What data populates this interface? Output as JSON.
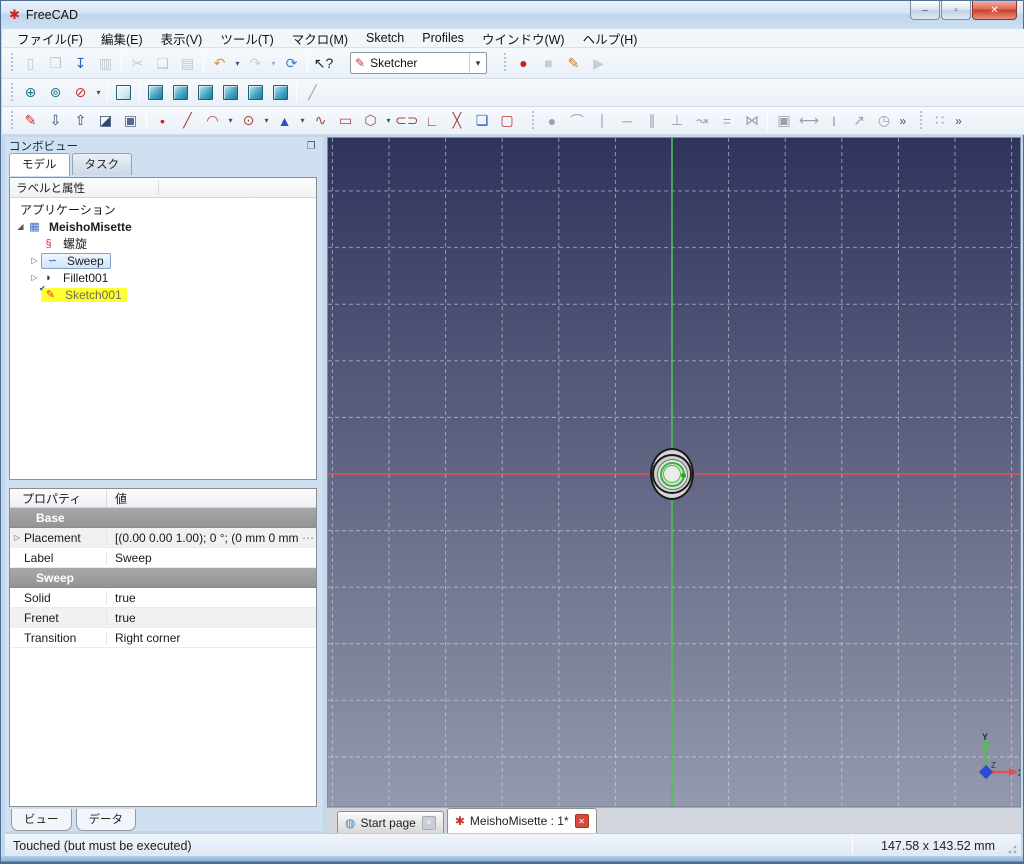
{
  "window": {
    "title": "FreeCAD",
    "icon": "freecad-logo-icon",
    "icon_glyph": "✱",
    "buttons": [
      {
        "id": "minimize",
        "glyph": "‒"
      },
      {
        "id": "maximize",
        "glyph": "▫"
      },
      {
        "id": "close",
        "glyph": "✕"
      }
    ]
  },
  "menu": {
    "items": [
      {
        "id": "file",
        "label": "ファイル(F)"
      },
      {
        "id": "edit",
        "label": "編集(E)"
      },
      {
        "id": "view",
        "label": "表示(V)"
      },
      {
        "id": "tools",
        "label": "ツール(T)"
      },
      {
        "id": "macro",
        "label": "マクロ(M)"
      },
      {
        "id": "sketch",
        "label": "Sketch"
      },
      {
        "id": "profiles",
        "label": "Profiles"
      },
      {
        "id": "windows",
        "label": "ウインドウ(W)"
      },
      {
        "id": "help",
        "label": "ヘルプ(H)"
      }
    ]
  },
  "workbench": {
    "selected": "Sketcher",
    "icon_glyph": "✎",
    "icon_color": "#cc3333"
  },
  "ui": {
    "dropdown_arrow": "▾",
    "overflow": "»",
    "expander_expanded": "◢",
    "expander_collapsed": "▷",
    "ellipsis": "⋯",
    "float_glyph": "❐",
    "close_glyph": "✕"
  },
  "toolbars": {
    "rows": [
      [
        {
          "k": "grip"
        },
        {
          "k": "btn",
          "n": "new-file-button",
          "g": "▯",
          "c": "#7e8ea0",
          "d": true
        },
        {
          "k": "btn",
          "n": "open-file-button",
          "g": "❒",
          "c": "#7e8ea0",
          "d": true
        },
        {
          "k": "btn",
          "n": "save-button",
          "g": "↧",
          "c": "#2f66c4"
        },
        {
          "k": "btn",
          "n": "print-button",
          "g": "▥",
          "c": "#7e8ea0",
          "d": true
        },
        {
          "k": "sep"
        },
        {
          "k": "btn",
          "n": "cut-button",
          "g": "✂",
          "c": "#7e8ea0",
          "d": true
        },
        {
          "k": "btn",
          "n": "copy-button",
          "g": "❏",
          "c": "#7e8ea0",
          "d": true
        },
        {
          "k": "btn",
          "n": "paste-button",
          "g": "▤",
          "c": "#7e8ea0",
          "d": true
        },
        {
          "k": "sep"
        },
        {
          "k": "btn",
          "n": "undo-button",
          "g": "↶",
          "c": "#d69a2a",
          "dd": true
        },
        {
          "k": "btn",
          "n": "redo-button",
          "g": "↷",
          "c": "#8e99a6",
          "d": true,
          "dd": true
        },
        {
          "k": "btn",
          "n": "refresh-button",
          "g": "⟳",
          "c": "#3a7bd5"
        },
        {
          "k": "sep"
        },
        {
          "k": "btn",
          "n": "whats-this-button",
          "g": "↖?",
          "c": "#20262e"
        },
        {
          "k": "gap",
          "w": 14
        },
        {
          "k": "combo"
        },
        {
          "k": "gap",
          "w": 12
        },
        {
          "k": "grip"
        },
        {
          "k": "btn",
          "n": "macro-record-button",
          "g": "●",
          "c": "#cf2020"
        },
        {
          "k": "btn",
          "n": "macro-stop-button",
          "g": "■",
          "c": "#8e99a6",
          "d": true
        },
        {
          "k": "btn",
          "n": "macro-edit-button",
          "g": "✎",
          "c": "#c07a28"
        },
        {
          "k": "btn",
          "n": "macro-play-button",
          "g": "▶",
          "c": "#8e99a6",
          "d": true
        }
      ],
      [
        {
          "k": "grip"
        },
        {
          "k": "btn",
          "n": "fit-all-button",
          "g": "⊕",
          "c": "#1f7a8c"
        },
        {
          "k": "btn",
          "n": "zoom-region-button",
          "g": "⊚",
          "c": "#1f7a8c"
        },
        {
          "k": "btn",
          "n": "draw-style-button",
          "g": "⊘",
          "c": "#c23333",
          "dd": true
        },
        {
          "k": "sep"
        },
        {
          "k": "cube",
          "n": "view-axonometric-button",
          "variant": "light"
        },
        {
          "k": "sep"
        },
        {
          "k": "cube",
          "n": "view-front-button"
        },
        {
          "k": "cube",
          "n": "view-top-button"
        },
        {
          "k": "cube",
          "n": "view-right-button"
        },
        {
          "k": "cube",
          "n": "view-rear-button"
        },
        {
          "k": "cube",
          "n": "view-bottom-button"
        },
        {
          "k": "cube",
          "n": "view-left-button"
        },
        {
          "k": "sep"
        },
        {
          "k": "btn",
          "n": "measure-distance-button",
          "g": "╱",
          "c": "#9aa4af"
        }
      ],
      [
        {
          "k": "grip"
        },
        {
          "k": "btn",
          "n": "new-sketch-button",
          "g": "✎",
          "c": "#c23333"
        },
        {
          "k": "btn",
          "n": "leave-sketch-button",
          "g": "⇩",
          "c": "#2f4a6e"
        },
        {
          "k": "btn",
          "n": "view-sketch-button",
          "g": "⇧",
          "c": "#2f4a6e"
        },
        {
          "k": "btn",
          "n": "view-section-button",
          "g": "◪",
          "c": "#2f4a6e"
        },
        {
          "k": "btn",
          "n": "map-sketch-button",
          "g": "▣",
          "c": "#56688a"
        },
        {
          "k": "sep"
        },
        {
          "k": "btn",
          "n": "create-point-button",
          "g": "•",
          "c": "#cc2222"
        },
        {
          "k": "btn",
          "n": "create-line-button",
          "g": "╱",
          "c": "#a94444"
        },
        {
          "k": "btn",
          "n": "create-arc-button",
          "g": "◠",
          "c": "#a94444",
          "dd": true
        },
        {
          "k": "btn",
          "n": "create-circle-button",
          "g": "⊙",
          "c": "#a94444",
          "dd": true
        },
        {
          "k": "btn",
          "n": "create-conic-button",
          "g": "▲",
          "c": "#2a52be",
          "dd": true
        },
        {
          "k": "btn",
          "n": "create-polyline-button",
          "g": "∿",
          "c": "#a94444"
        },
        {
          "k": "btn",
          "n": "create-rectangle-button",
          "g": "▭",
          "c": "#a94444"
        },
        {
          "k": "btn",
          "n": "create-polygon-button",
          "g": "⬡",
          "c": "#a94444",
          "dd": true
        },
        {
          "k": "btn",
          "n": "create-slot-button",
          "g": "⊂⊃",
          "c": "#a94444"
        },
        {
          "k": "btn",
          "n": "create-fillet-button",
          "g": "∟",
          "c": "#a94444"
        },
        {
          "k": "btn",
          "n": "trim-edge-button",
          "g": "╳",
          "c": "#a94444"
        },
        {
          "k": "btn",
          "n": "external-geometry-button",
          "g": "❏",
          "c": "#2a52be"
        },
        {
          "k": "btn",
          "n": "construction-mode-button",
          "g": "▢",
          "c": "#c23333"
        },
        {
          "k": "gap",
          "w": 8
        },
        {
          "k": "grip"
        },
        {
          "k": "btn",
          "n": "constraint-coincident-button",
          "g": "●",
          "c": "#97a0ab"
        },
        {
          "k": "btn",
          "n": "constraint-point-on-object-button",
          "g": "⌒",
          "c": "#97a0ab"
        },
        {
          "k": "btn",
          "n": "constraint-vertical-button",
          "g": "∣",
          "c": "#97a0ab"
        },
        {
          "k": "btn",
          "n": "constraint-horizontal-button",
          "g": "─",
          "c": "#97a0ab"
        },
        {
          "k": "btn",
          "n": "constraint-parallel-button",
          "g": "∥",
          "c": "#97a0ab"
        },
        {
          "k": "btn",
          "n": "constraint-perpendicular-button",
          "g": "⊥",
          "c": "#97a0ab"
        },
        {
          "k": "btn",
          "n": "constraint-tangent-button",
          "g": "↝",
          "c": "#97a0ab"
        },
        {
          "k": "btn",
          "n": "constraint-equal-button",
          "g": "=",
          "c": "#97a0ab"
        },
        {
          "k": "btn",
          "n": "constraint-symmetric-button",
          "g": "⋈",
          "c": "#97a0ab"
        },
        {
          "k": "sep"
        },
        {
          "k": "btn",
          "n": "constraint-lock-button",
          "g": "▣",
          "c": "#97a0ab"
        },
        {
          "k": "btn",
          "n": "constraint-horizontal-distance-button",
          "g": "⟷",
          "c": "#97a0ab"
        },
        {
          "k": "btn",
          "n": "constraint-vertical-distance-button",
          "g": "I",
          "c": "#97a0ab"
        },
        {
          "k": "btn",
          "n": "constraint-distance-button",
          "g": "↗",
          "c": "#97a0ab"
        },
        {
          "k": "btn",
          "n": "constraint-radius-button",
          "g": "◷",
          "c": "#97a0ab"
        },
        {
          "k": "ovf"
        },
        {
          "k": "gap",
          "w": 6
        },
        {
          "k": "grip"
        },
        {
          "k": "btn",
          "n": "bspline-tools-button",
          "g": "∷",
          "c": "#97a0ab"
        },
        {
          "k": "ovf"
        }
      ]
    ]
  },
  "combo_view": {
    "title": "コンボビュー",
    "tabs": [
      {
        "id": "model",
        "label": "モデル",
        "active": true
      },
      {
        "id": "tasks",
        "label": "タスク",
        "active": false
      }
    ],
    "tree_header": "ラベルと属性",
    "items": [
      {
        "id": "application",
        "label": "アプリケーション",
        "indent": 0,
        "plain": true
      },
      {
        "id": "document-meishomisette",
        "label": "MeishoMisette",
        "indent": 0,
        "expander": "expanded",
        "icon": "document-icon",
        "glyph": "▦",
        "color": "#3a66cc",
        "bold": true
      },
      {
        "id": "helix",
        "label": "螺旋",
        "indent": 1,
        "icon": "helix-icon",
        "glyph": "§",
        "color": "#cc3344"
      },
      {
        "id": "sweep",
        "label": "Sweep",
        "indent": 1,
        "expander": "collapsed",
        "icon": "sweep-icon",
        "glyph": "∽",
        "color": "#2255cc",
        "state": "selected"
      },
      {
        "id": "fillet001",
        "label": "Fillet001",
        "indent": 1,
        "expander": "collapsed",
        "icon": "fillet-icon",
        "glyph": "◗",
        "color": "#223a66"
      },
      {
        "id": "sketch001",
        "label": "Sketch001",
        "indent": 1,
        "icon": "sketch-icon",
        "glyph": "✎",
        "color": "#cc3333",
        "badge": "✔",
        "state": "highlight"
      }
    ],
    "bottom_tabs": [
      {
        "id": "view",
        "label": "ビュー",
        "active": true
      },
      {
        "id": "data",
        "label": "データ",
        "active": false
      }
    ]
  },
  "properties": {
    "header": {
      "name": "プロパティ",
      "value": "値"
    },
    "rows": [
      {
        "type": "group",
        "label": "Base"
      },
      {
        "type": "row",
        "name": "Placement",
        "value": "[(0.00 0.00 1.00); 0 °; (0 mm  0 mm",
        "expand": true,
        "ellipsis": true,
        "shaded": true
      },
      {
        "type": "row",
        "name": "Label",
        "value": "Sweep"
      },
      {
        "type": "group",
        "label": "Sweep"
      },
      {
        "type": "row",
        "name": "Solid",
        "value": "true"
      },
      {
        "type": "row",
        "name": "Frenet",
        "value": "true",
        "shaded": true
      },
      {
        "type": "row",
        "name": "Transition",
        "value": "Right corner"
      }
    ]
  },
  "viewport": {
    "colors": {
      "bg_top": "#30335c",
      "bg_bottom": "#9499ad",
      "grid": "#dde1ea",
      "x_axis": "#e0524c",
      "y_axis": "#4fc04f",
      "z_axis": "#2b4bd0"
    },
    "axis_labels": {
      "x": "X",
      "y": "Y",
      "z": "Z"
    }
  },
  "mdi": {
    "tabs": [
      {
        "id": "start-page",
        "label": "Start page",
        "icon": "globe-icon",
        "icon_glyph": "◍",
        "icon_color": "#4a84c8",
        "active": false,
        "close": "gray"
      },
      {
        "id": "meishomisette-doc",
        "label": "MeishoMisette : 1*",
        "icon": "freecad-doc-icon",
        "icon_glyph": "✱",
        "icon_color": "#cc3322",
        "active": true,
        "close": "red"
      }
    ]
  },
  "statusbar": {
    "left": "Touched (but must be executed)",
    "right": "147.58 x 143.52 mm"
  }
}
